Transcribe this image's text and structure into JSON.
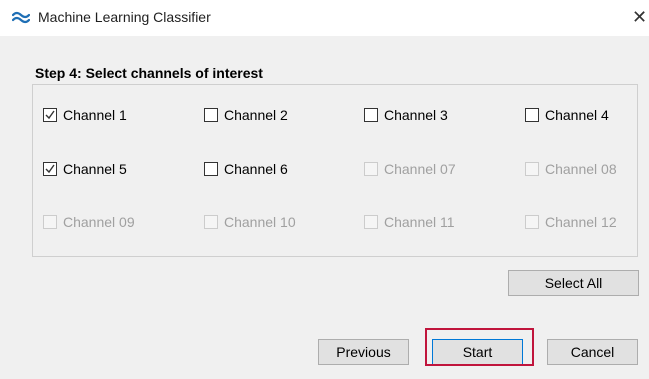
{
  "window": {
    "title": "Machine Learning Classifier",
    "close_glyph": "✕",
    "app_icon": "wave-logo-icon"
  },
  "step": {
    "title": "Step 4: Select channels of interest"
  },
  "channels": [
    {
      "label": "Channel 1",
      "checked": true,
      "enabled": true
    },
    {
      "label": "Channel 2",
      "checked": false,
      "enabled": true
    },
    {
      "label": "Channel 3",
      "checked": false,
      "enabled": true
    },
    {
      "label": "Channel 4",
      "checked": false,
      "enabled": true
    },
    {
      "label": "Channel 5",
      "checked": true,
      "enabled": true
    },
    {
      "label": "Channel 6",
      "checked": false,
      "enabled": true
    },
    {
      "label": "Channel 07",
      "checked": false,
      "enabled": false
    },
    {
      "label": "Channel 08",
      "checked": false,
      "enabled": false
    },
    {
      "label": "Channel 09",
      "checked": false,
      "enabled": false
    },
    {
      "label": "Channel 10",
      "checked": false,
      "enabled": false
    },
    {
      "label": "Channel 11",
      "checked": false,
      "enabled": false
    },
    {
      "label": "Channel 12",
      "checked": false,
      "enabled": false
    }
  ],
  "buttons": {
    "select_all": "Select All",
    "previous": "Previous",
    "start": "Start",
    "cancel": "Cancel"
  },
  "colors": {
    "highlight": "#c0143c",
    "accent": "#0078d7"
  }
}
